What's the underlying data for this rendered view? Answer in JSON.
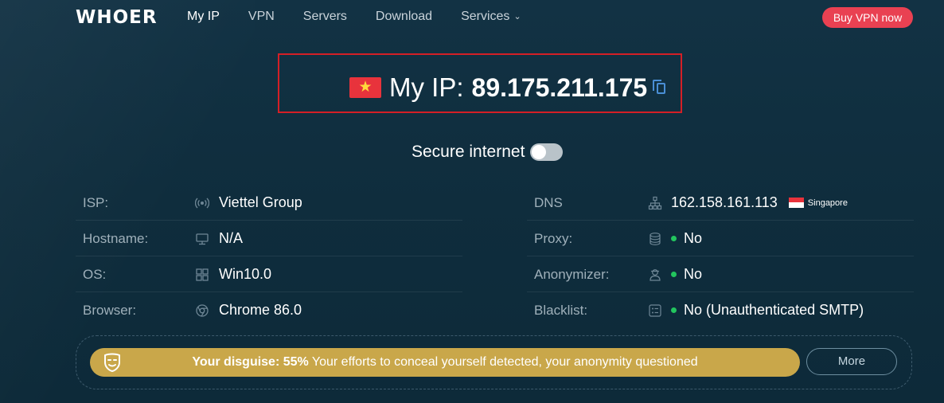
{
  "header": {
    "logo": "WHOER",
    "nav": [
      {
        "label": "My IP",
        "active": true
      },
      {
        "label": "VPN",
        "active": false
      },
      {
        "label": "Servers",
        "active": false
      },
      {
        "label": "Download",
        "active": false
      },
      {
        "label": "Services",
        "active": false,
        "has_dropdown": true
      }
    ],
    "buy_label": "Buy VPN now",
    "buy_color": "#e94152"
  },
  "ip": {
    "label": "My IP:",
    "value": "89.175.211.175",
    "flag_icon": "vietnam-flag-icon"
  },
  "secure": {
    "label": "Secure internet",
    "enabled": false
  },
  "left_info": [
    {
      "label": "ISP:",
      "icon": "broadcast-icon",
      "value": "Viettel Group"
    },
    {
      "label": "Hostname:",
      "icon": "monitor-icon",
      "value": "N/A"
    },
    {
      "label": "OS:",
      "icon": "windows-icon",
      "value": "Win10.0"
    },
    {
      "label": "Browser:",
      "icon": "chrome-icon",
      "value": "Chrome 86.0"
    }
  ],
  "right_info": [
    {
      "label": "DNS",
      "icon": "network-icon",
      "value": "162.158.161.113",
      "country": "Singapore",
      "country_flag": "singapore-flag-icon"
    },
    {
      "label": "Proxy:",
      "icon": "database-icon",
      "value": "No",
      "status_color": "#22c55e"
    },
    {
      "label": "Anonymizer:",
      "icon": "user-icon",
      "value": "No",
      "status_color": "#22c55e"
    },
    {
      "label": "Blacklist:",
      "icon": "list-icon",
      "value": "No (Unauthenticated SMTP)",
      "status_color": "#22c55e"
    }
  ],
  "disguise": {
    "prefix": "Your disguise: 55%",
    "message": " Your efforts to conceal yourself detected, your anonymity questioned",
    "percent": 55,
    "bar_color": "#c9a74a",
    "icon": "mask-icon",
    "more_label": "More"
  }
}
